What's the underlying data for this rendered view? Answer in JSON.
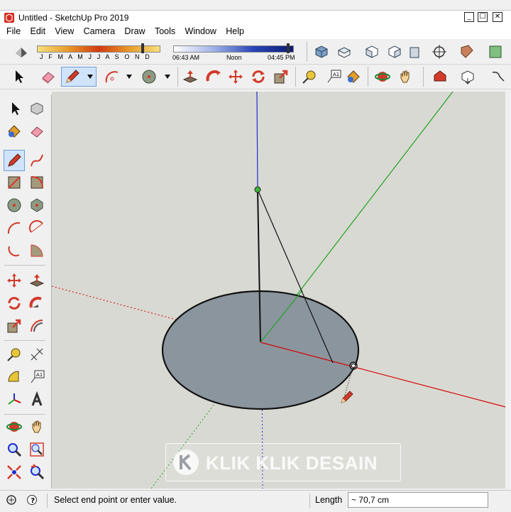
{
  "window": {
    "title": "Untitled - SketchUp Pro 2019",
    "controls": {
      "minimize": "_",
      "maximize": "☐",
      "close": "✕"
    }
  },
  "menu": [
    "File",
    "Edit",
    "View",
    "Camera",
    "Draw",
    "Tools",
    "Window",
    "Help"
  ],
  "shadow_settings": {
    "months": "J F M A M J J A S O N D",
    "time_start": "06:43 AM",
    "time_mid": "Noon",
    "time_end": "04:45 PM"
  },
  "tools": {
    "large_toolset": [
      "select",
      "component",
      "paint-bucket",
      "eraser",
      "line",
      "freehand",
      "rectangle",
      "rotated-rectangle",
      "circle",
      "polygon",
      "arc",
      "two-point-arc",
      "three-point-arc",
      "pie",
      "move",
      "push-pull",
      "rotate",
      "follow-me",
      "scale",
      "offset",
      "tape-measure",
      "dimension",
      "protractor",
      "text",
      "axes",
      "3d-text",
      "orbit",
      "pan",
      "zoom",
      "zoom-window",
      "zoom-extents",
      "previous"
    ],
    "active_tool": "line"
  },
  "viewport": {
    "colors": {
      "background": "#d9d9d3",
      "face": "#8b959e",
      "red_axis": "#d40000",
      "green_axis": "#1fa31f",
      "blue_axis": "#1f2bd0"
    }
  },
  "watermark": {
    "text": "KLIK KLIK DESAIN"
  },
  "status": {
    "message": "Select end point or enter value.",
    "measurement_label": "Length",
    "measurement_value": "~ 70,7 cm"
  }
}
